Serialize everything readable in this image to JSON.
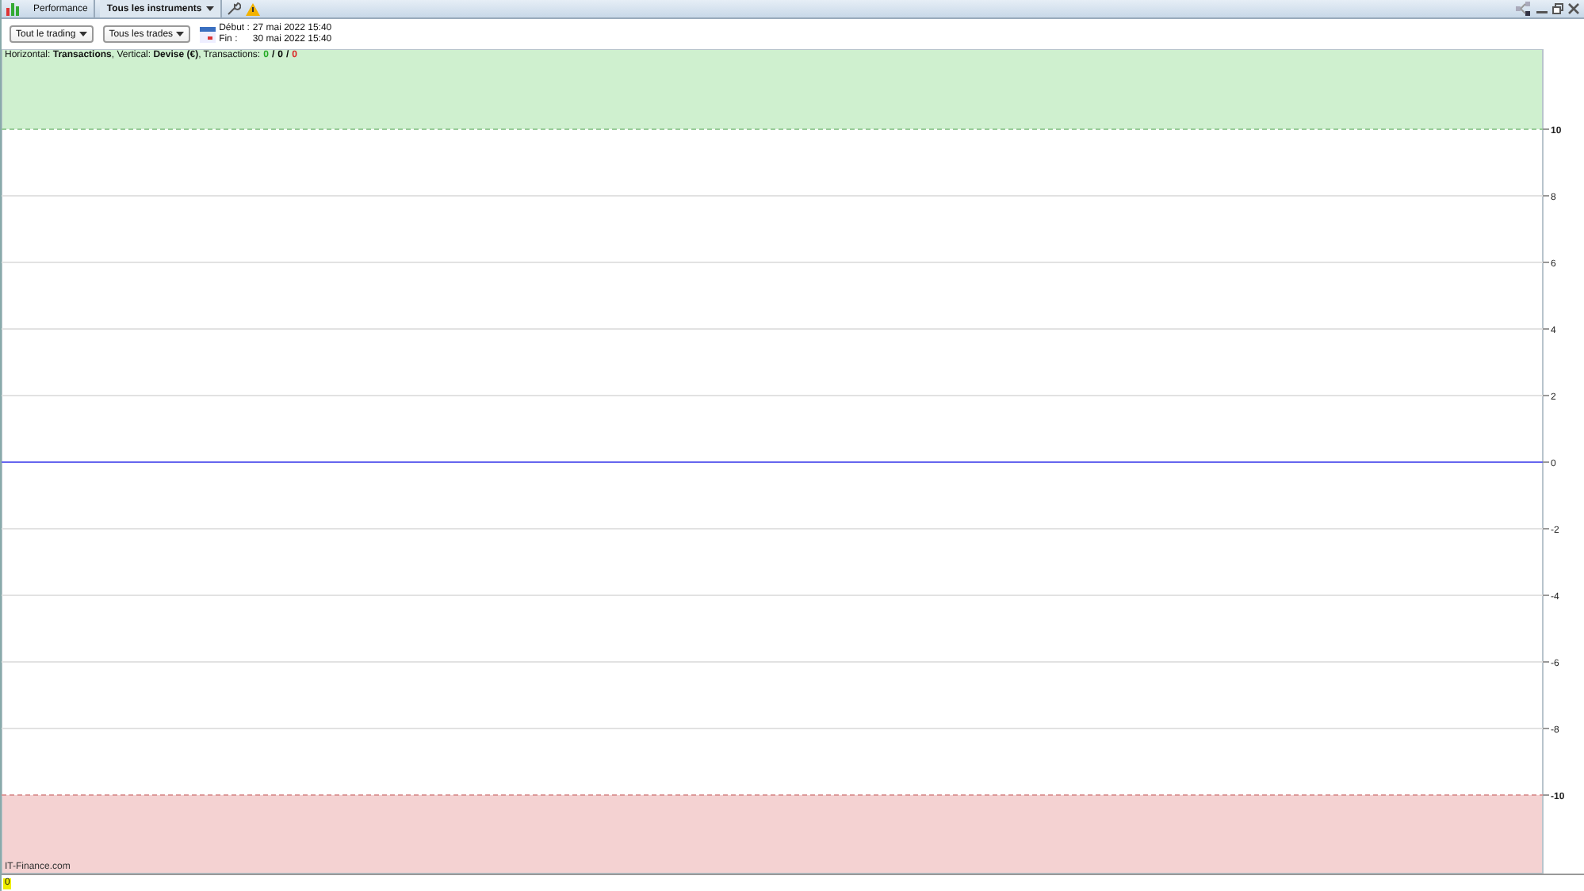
{
  "title_bar": {
    "tabs": [
      {
        "label": "Performance",
        "selected": false
      },
      {
        "label": "Tous les instruments",
        "selected": true
      }
    ]
  },
  "toolbar": {
    "dropdowns": [
      "Tout le trading",
      "Tous les trades"
    ],
    "period": {
      "start_label": "Début :",
      "start": "27 mai 2022 15:40",
      "end_label": "Fin :",
      "end": "30 mai 2022 15:40"
    }
  },
  "chart": {
    "legend": "Horizontal: **Transactions**, Vertical: **Devise (€)**, Transactions:",
    "counts": [
      {
        "text": "0",
        "color": "#22aa22"
      },
      {
        "text": "/",
        "color": "#000000"
      },
      {
        "text": "0",
        "color": "#000000"
      },
      {
        "text": "/",
        "color": "#000000"
      },
      {
        "text": "0",
        "color": "#dd2222"
      }
    ],
    "footer": "IT-Finance.com",
    "axis_labels": [
      {
        "text": "10",
        "kind": "upper"
      },
      {
        "text": "8",
        "kind": "grid"
      },
      {
        "text": "6",
        "kind": "grid"
      },
      {
        "text": "4",
        "kind": "grid"
      },
      {
        "text": "2",
        "kind": "grid"
      },
      {
        "text": "0",
        "kind": "baseline"
      },
      {
        "text": "-2",
        "kind": "grid"
      },
      {
        "text": "-4",
        "kind": "grid"
      },
      {
        "text": "-6",
        "kind": "grid"
      },
      {
        "text": "-8",
        "kind": "grid"
      },
      {
        "text": "-10",
        "kind": "lower"
      }
    ]
  },
  "status_bar": {
    "badge": "0"
  }
}
